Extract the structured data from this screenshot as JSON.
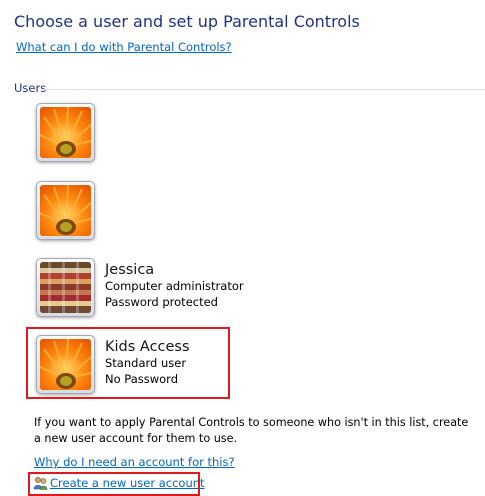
{
  "header": {
    "title": "Choose a user and set up Parental Controls",
    "help_link": "What can I do with Parental Controls?"
  },
  "users_section": {
    "label": "Users",
    "users": [
      {
        "name": "",
        "type": "",
        "password": "",
        "picture": "flower-icon"
      },
      {
        "name": "",
        "type": "",
        "password": "",
        "picture": "flower-icon"
      },
      {
        "name": "Jessica",
        "type": "Computer administrator",
        "password": "Password protected",
        "picture": "textile-icon"
      },
      {
        "name": "Kids Access",
        "type": "Standard user",
        "password": "No Password",
        "picture": "flower-icon"
      }
    ]
  },
  "footer": {
    "info_text": "If you want to apply Parental Controls to someone who isn't in this list, create a new user account for them to use.",
    "why_link": "Why do I need an account for this?",
    "create_link": "Create a new user account"
  },
  "colors": {
    "title": "#1e3287",
    "link": "#0066cc",
    "highlight": "#e0191f"
  }
}
